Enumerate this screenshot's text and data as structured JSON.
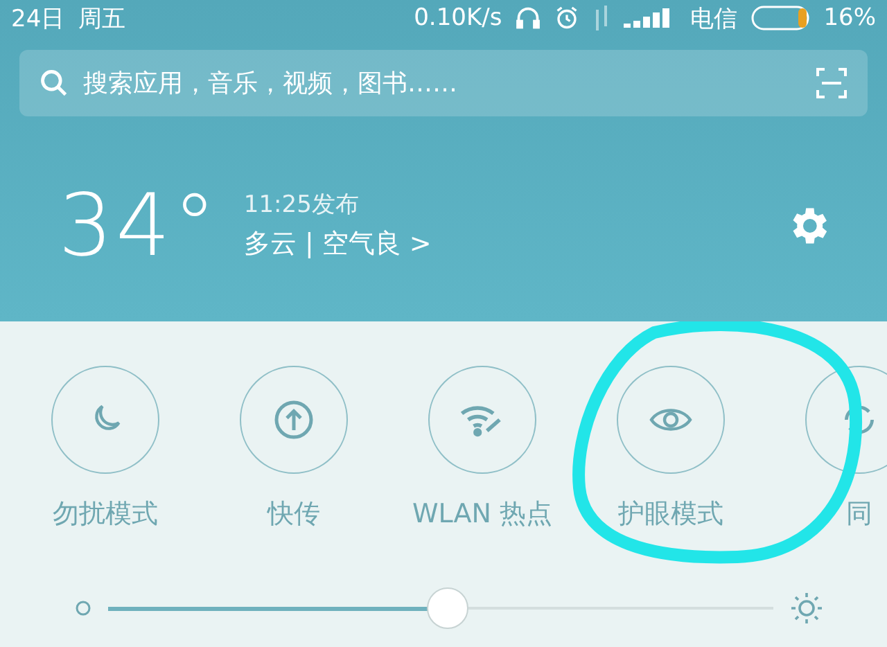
{
  "status_bar": {
    "date": "24日",
    "weekday": "周五",
    "speed": "0.10K/s",
    "carrier": "电信",
    "battery": "16%"
  },
  "search": {
    "placeholder": "搜索应用，音乐，视频，图书……"
  },
  "weather": {
    "temperature": "34°",
    "published": "11:25发布",
    "condition": "多云 | 空气良 >"
  },
  "toggles": [
    {
      "label": "勿扰模式"
    },
    {
      "label": "快传"
    },
    {
      "label": "WLAN 热点"
    },
    {
      "label": "护眼模式"
    },
    {
      "label": "同"
    }
  ],
  "brightness": {
    "level": 0.51
  }
}
